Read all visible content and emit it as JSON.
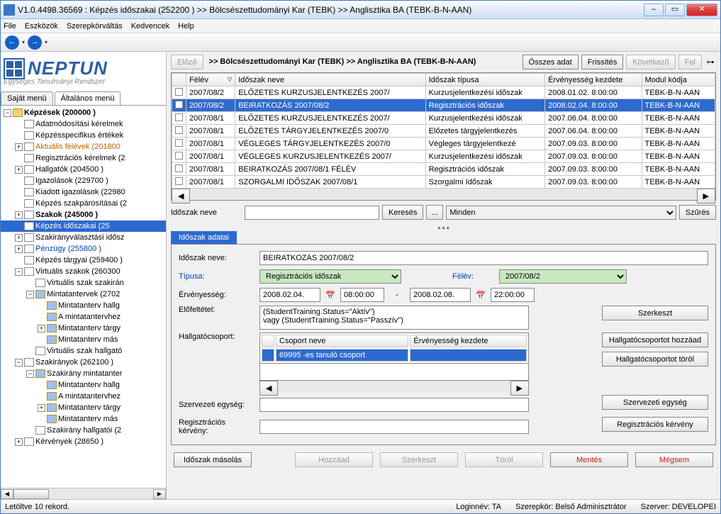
{
  "titlebar": "V1.0.4498.36569 : Képzés időszakai (252200  )  >> Bölcsészettudományi Kar (TEBK) >> Anglisztika BA (TEBK-B-N-AAN)",
  "menu": {
    "file": "File",
    "tools": "Eszközök",
    "roleswitch": "Szerepkörváltás",
    "favorites": "Kedvencek",
    "help": "Help"
  },
  "logo": {
    "brand": "NEPTUN",
    "tagline": "Egységes Tanulmányi Rendszer"
  },
  "lefttabs": {
    "own": "Saját menü",
    "general": "Általános menü"
  },
  "tree": [
    {
      "indent": 0,
      "exp": "-",
      "ico": "fold",
      "label": "Képzések (200000  )",
      "bold": true
    },
    {
      "indent": 1,
      "exp": "",
      "ico": "doc",
      "label": "Adatmódosítási kérelmek"
    },
    {
      "indent": 1,
      "exp": "",
      "ico": "doc",
      "label": "Képzésspecifikus értékek"
    },
    {
      "indent": 1,
      "exp": "+",
      "ico": "doc",
      "label": "Aktuális félévek (201800",
      "cls": "orange"
    },
    {
      "indent": 1,
      "exp": "",
      "ico": "doc",
      "label": "Regisztrációs kérelmek (2"
    },
    {
      "indent": 1,
      "exp": "+",
      "ico": "doc",
      "label": "Hallgatók (204500  )"
    },
    {
      "indent": 1,
      "exp": "",
      "ico": "doc",
      "label": "Igazolások (229700  )"
    },
    {
      "indent": 1,
      "exp": "",
      "ico": "doc",
      "label": "Kiadott igazolások (22980"
    },
    {
      "indent": 1,
      "exp": "",
      "ico": "doc",
      "label": "Képzés szakpárosításai (2"
    },
    {
      "indent": 1,
      "exp": "+",
      "ico": "doc",
      "label": "Szakok (245000  )",
      "bold": true
    },
    {
      "indent": 1,
      "exp": "",
      "ico": "doc",
      "label": "Képzés időszakai (25",
      "sel": true
    },
    {
      "indent": 1,
      "exp": "+",
      "ico": "doc",
      "label": "Szakirányválasztási idősz"
    },
    {
      "indent": 1,
      "exp": "+",
      "ico": "doc",
      "label": "Pénzügy (255800  )",
      "cls": "blue"
    },
    {
      "indent": 1,
      "exp": "",
      "ico": "doc",
      "label": "Képzés tárgyai (259400  )"
    },
    {
      "indent": 1,
      "exp": "-",
      "ico": "doc",
      "label": "Virtuális szakok (260300"
    },
    {
      "indent": 2,
      "exp": "",
      "ico": "doc",
      "label": "Virtuális szak szakirán"
    },
    {
      "indent": 2,
      "exp": "-",
      "ico": "blue",
      "label": "Mintatantervek (2702"
    },
    {
      "indent": 3,
      "exp": "",
      "ico": "blue",
      "label": "Mintatanterv hallg"
    },
    {
      "indent": 3,
      "exp": "",
      "ico": "blue",
      "label": "A mintatantervhez"
    },
    {
      "indent": 3,
      "exp": "+",
      "ico": "blue",
      "label": "Mintatanterv tárgy"
    },
    {
      "indent": 3,
      "exp": "",
      "ico": "blue",
      "label": "Mintatanterv más"
    },
    {
      "indent": 2,
      "exp": "",
      "ico": "doc",
      "label": "Virtuális szak hallgató"
    },
    {
      "indent": 1,
      "exp": "-",
      "ico": "doc",
      "label": "Szakirányok (262100  )"
    },
    {
      "indent": 2,
      "exp": "-",
      "ico": "blue",
      "label": "Szakirány mintatanter"
    },
    {
      "indent": 3,
      "exp": "",
      "ico": "blue",
      "label": "Mintatanterv hallg"
    },
    {
      "indent": 3,
      "exp": "",
      "ico": "blue",
      "label": "A mintatantervhez"
    },
    {
      "indent": 3,
      "exp": "+",
      "ico": "blue",
      "label": "Mintatanterv tárgy"
    },
    {
      "indent": 3,
      "exp": "",
      "ico": "blue",
      "label": "Mintatanterv más"
    },
    {
      "indent": 2,
      "exp": "",
      "ico": "doc",
      "label": "Szakirány hallgatói (2"
    },
    {
      "indent": 1,
      "exp": "+",
      "ico": "doc",
      "label": "Kérvények (28650  )"
    }
  ],
  "toolbar": {
    "prev": "Előző",
    "breadcrumb": ">> Bölcsészettudományi Kar (TEBK) >> Anglisztika BA (TEBK-B-N-AAN)",
    "alldata": "Összes adat",
    "refresh": "Frissítés",
    "next": "Következő",
    "up": "Fel"
  },
  "grid": {
    "cols": [
      "",
      "Félév",
      "Időszak neve",
      "Időszak típusa",
      "Érvényesség kezdete",
      "Modul kódja"
    ],
    "rows": [
      [
        "",
        "2007/08/2",
        "ELŐZETES KURZUSJELENTKEZÉS 2007/",
        "Kurzusjelentkezési időszak",
        "2008.01.02. 8:00:00",
        "TEBK-B-N-AAN"
      ],
      [
        "",
        "2007/08/2",
        "BEIRATKOZÁS 2007/08/2",
        "Regisztrációs időszak",
        "2008.02.04. 8:00:00",
        "TEBK-B-N-AAN"
      ],
      [
        "",
        "2007/08/1",
        "ELŐZETES KURZUSJELENTKEZÉS 2007/",
        "Kurzusjelentkezési időszak",
        "2007.06.04. 8:00:00",
        "TEBK-B-N-AAN"
      ],
      [
        "",
        "2007/08/1",
        "ELŐZETES TÁRGYJELENTKEZÉS 2007/0",
        "Előzetes tárgyjelentkezés",
        "2007.06.04. 8:00:00",
        "TEBK-B-N-AAN"
      ],
      [
        "",
        "2007/08/1",
        "VÉGLEGES TÁRGYJELENTKEZÉS 2007/0",
        "Végleges tárgyjelentkezé",
        "2007.09.03. 8:00:00",
        "TEBK-B-N-AAN"
      ],
      [
        "",
        "2007/08/1",
        "VÉGLEGES KURZUSJELENTKEZÉS 2007/",
        "Kurzusjelentkezési időszak",
        "2007.09.03. 8:00:00",
        "TEBK-B-N-AAN"
      ],
      [
        "",
        "2007/08/1",
        "BEIRATKOZÁS 2007/08/1 FÉLÉV",
        "Regisztrációs időszak",
        "2007.09.03. 8:00:00",
        "TEBK-B-N-AAN"
      ],
      [
        "",
        "2007/08/1",
        "SZORGALMI IDŐSZAK 2007/08/1",
        "Szorgalmi Időszak",
        "2007.09.03. 8:00:00",
        "TEBK-B-N-AAN"
      ]
    ],
    "selRow": 1
  },
  "search": {
    "label": "Időszak neve",
    "value": "",
    "searchBtn": "Keresés",
    "moreBtn": "...",
    "combo": "Minden",
    "filterBtn": "Szűrés"
  },
  "tab": {
    "title": "Időszak adatai"
  },
  "form": {
    "name_label": "Időszak neve:",
    "name_value": "BEIRATKOZÁS 2007/08/2",
    "type_label": "Típusa:",
    "type_value": "Regisztrációs időszak",
    "sem_label": "Félév:",
    "sem_value": "2007/08/2",
    "valid_label": "Érvényesség:",
    "valid_from_date": "2008.02.04.",
    "valid_from_time": "08:00:00",
    "dash": "-",
    "valid_to_date": "2008.02.08.",
    "valid_to_time": "22:00:00",
    "pre_label": "Előfeltétel:",
    "pre_text": "(StudentTraining.Status=\"Aktív\")\nvagy (StudentTraining.Status=\"Passzív\")",
    "editBtn": "Szerkeszt",
    "group_label": "Hallgatócsoport:",
    "group_cols": [
      "",
      "Csoport neve",
      "Érvényesség kezdete"
    ],
    "group_row": [
      "",
      "69995 -es tanuló csoport",
      ""
    ],
    "addGroupBtn": "Hallgatócsoportot hozzáad",
    "delGroupBtn": "Hallgatócsoportot töröl",
    "org_label": "Szervezeti egység:",
    "org_value": "",
    "orgBtn": "Szervezeti egység",
    "regreq_label": "Regisztrációs kérvény:",
    "regreq_value": "",
    "regreqBtn": "Regisztrációs kérvény"
  },
  "bottom": {
    "copy": "Időszak másolás",
    "add": "Hozzáad",
    "edit": "Szerkeszt",
    "del": "Töröl",
    "save": "Mentés",
    "cancel": "Mégsem"
  },
  "status": {
    "loaded": "Letöltve 10 rekord.",
    "login": "Loginnév: TA",
    "role": "Szerepkör: Belső Adminisztrátor",
    "server": "Szerver: DEVELOPEI"
  }
}
